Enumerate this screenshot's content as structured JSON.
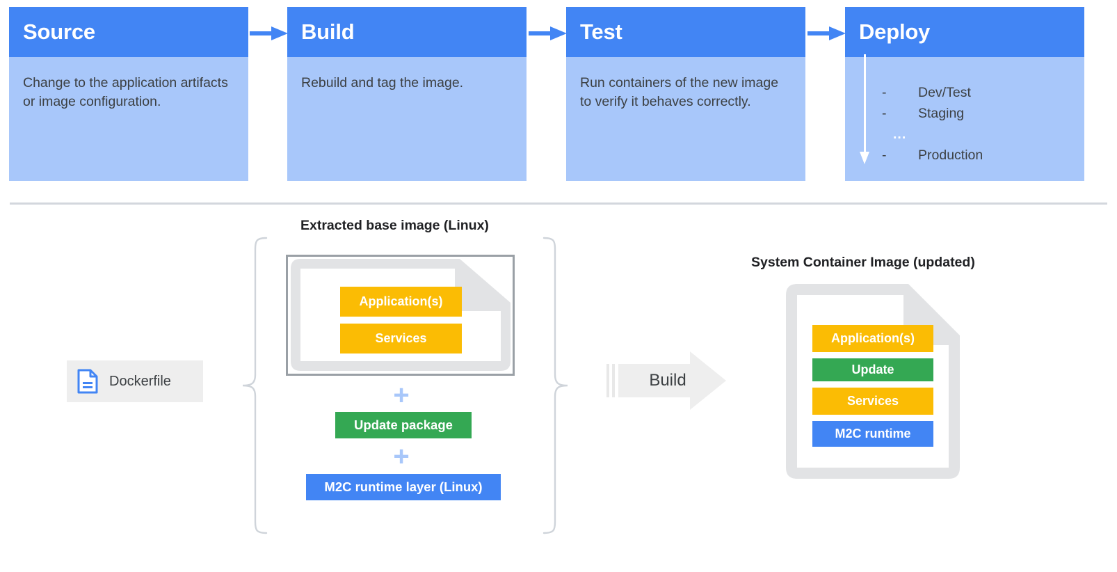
{
  "pipeline": {
    "stages": [
      {
        "title": "Source",
        "body": "Change to the application artifacts or image configuration."
      },
      {
        "title": "Build",
        "body": "Rebuild and tag the image."
      },
      {
        "title": "Test",
        "body": "Run containers of the new image to verify it behaves correctly."
      },
      {
        "title": "Deploy",
        "body": ""
      }
    ],
    "deploy_list": [
      {
        "dash": "-",
        "label": "Dev/Test"
      },
      {
        "dash": "-",
        "label": "Staging"
      },
      {
        "dash": "-",
        "label": "Production"
      }
    ],
    "deploy_ellipsis": "..."
  },
  "diagram": {
    "label_extracted": "Extracted base image (Linux)",
    "label_system": "System Container Image (updated)",
    "dockerfile_label": "Dockerfile",
    "build_label": "Build",
    "plus_symbol": "+",
    "extracted_layers": [
      {
        "label": "Application(s)"
      },
      {
        "label": "Services"
      }
    ],
    "update_package_label": "Update package",
    "m2c_layer_label": "M2C runtime layer (Linux)",
    "system_layers": [
      {
        "label": "Application(s)"
      },
      {
        "label": "Update"
      },
      {
        "label": "Services"
      },
      {
        "label": "M2C runtime"
      }
    ]
  },
  "colors": {
    "header_blue": "#4285f4",
    "body_blue": "#a8c7fa",
    "yellow": "#fbbc04",
    "green": "#34a853",
    "blue": "#4285f4",
    "gray": "#e0e0e0",
    "divider": "#d3d7dd",
    "text": "#3c4043"
  }
}
